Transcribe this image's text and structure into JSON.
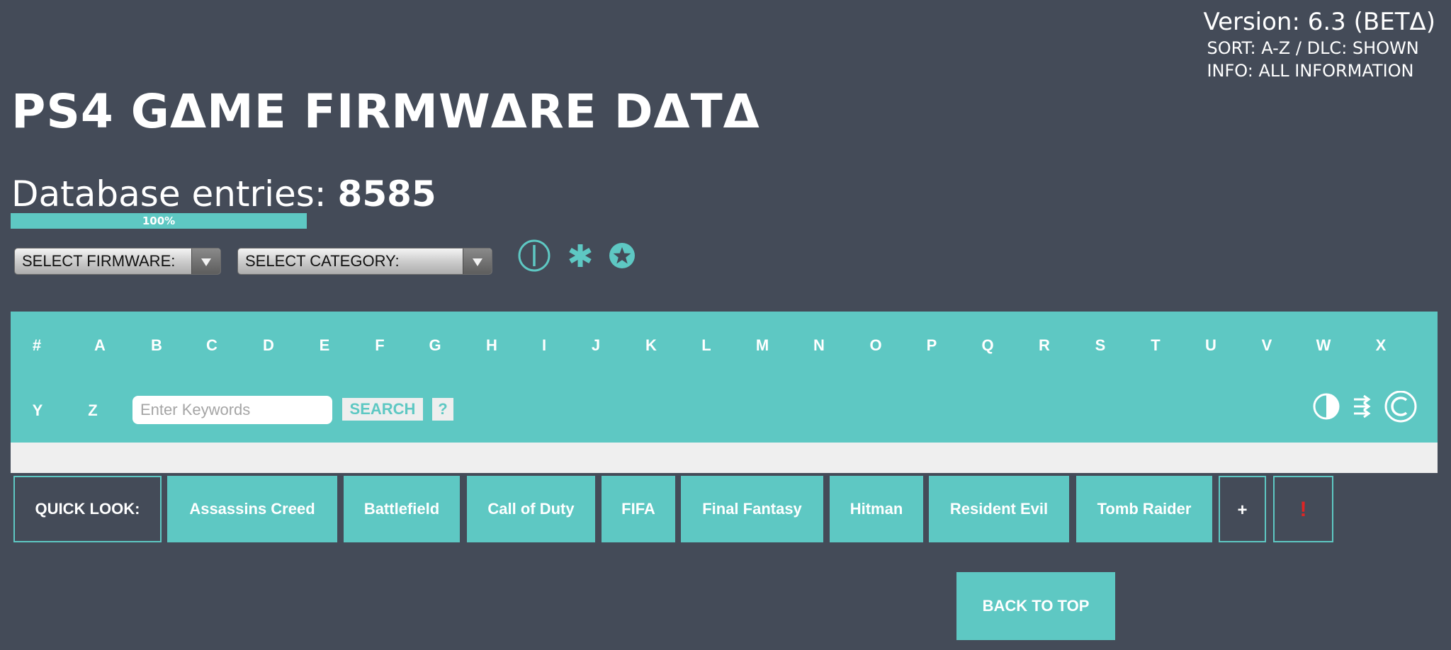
{
  "header": {
    "version": "Version: 6.3 (BETΔ)",
    "sort_line": "SORT: A-Z / DLC: SHOWN",
    "info_line": "INFO: ALL INFORMATION",
    "title": "PS4 GΔME FIRMWΔRE DΔTΔ"
  },
  "database": {
    "label": "Database entries:",
    "count": "8585",
    "progress_label": "100%",
    "progress_fraction": 1.0
  },
  "filters": {
    "firmware": "SELECT FIRMWARE:",
    "category": "SELECT CATEGORY:"
  },
  "tool_icons": [
    "power-icon",
    "asterisk-icon",
    "star-badge-icon"
  ],
  "alphabet": [
    "#",
    "A",
    "B",
    "C",
    "D",
    "E",
    "F",
    "G",
    "H",
    "I",
    "J",
    "K",
    "L",
    "M",
    "N",
    "O",
    "P",
    "Q",
    "R",
    "S",
    "T",
    "U",
    "V",
    "W",
    "X",
    "Y",
    "Z"
  ],
  "search": {
    "placeholder": "Enter Keywords",
    "value": "",
    "button_label": "SEARCH",
    "help_label": "?"
  },
  "bar_icons": [
    "contrast-icon",
    "list-arrows-icon",
    "copyright-icon"
  ],
  "quick_look": {
    "label": "QUICK LOOK:",
    "items": [
      "Assassins Creed",
      "Battlefield",
      "Call of Duty",
      "FIFA",
      "Final Fantasy",
      "Hitman",
      "Resident Evil",
      "Tomb Raider"
    ],
    "plus_label": "+",
    "alert_label": "!"
  },
  "footer": {
    "back_to_top": "BACK TO TOP"
  },
  "colors": {
    "background": "#444b58",
    "accent": "#5ec8c3",
    "strip": "#efefef",
    "alert": "#e02424"
  }
}
